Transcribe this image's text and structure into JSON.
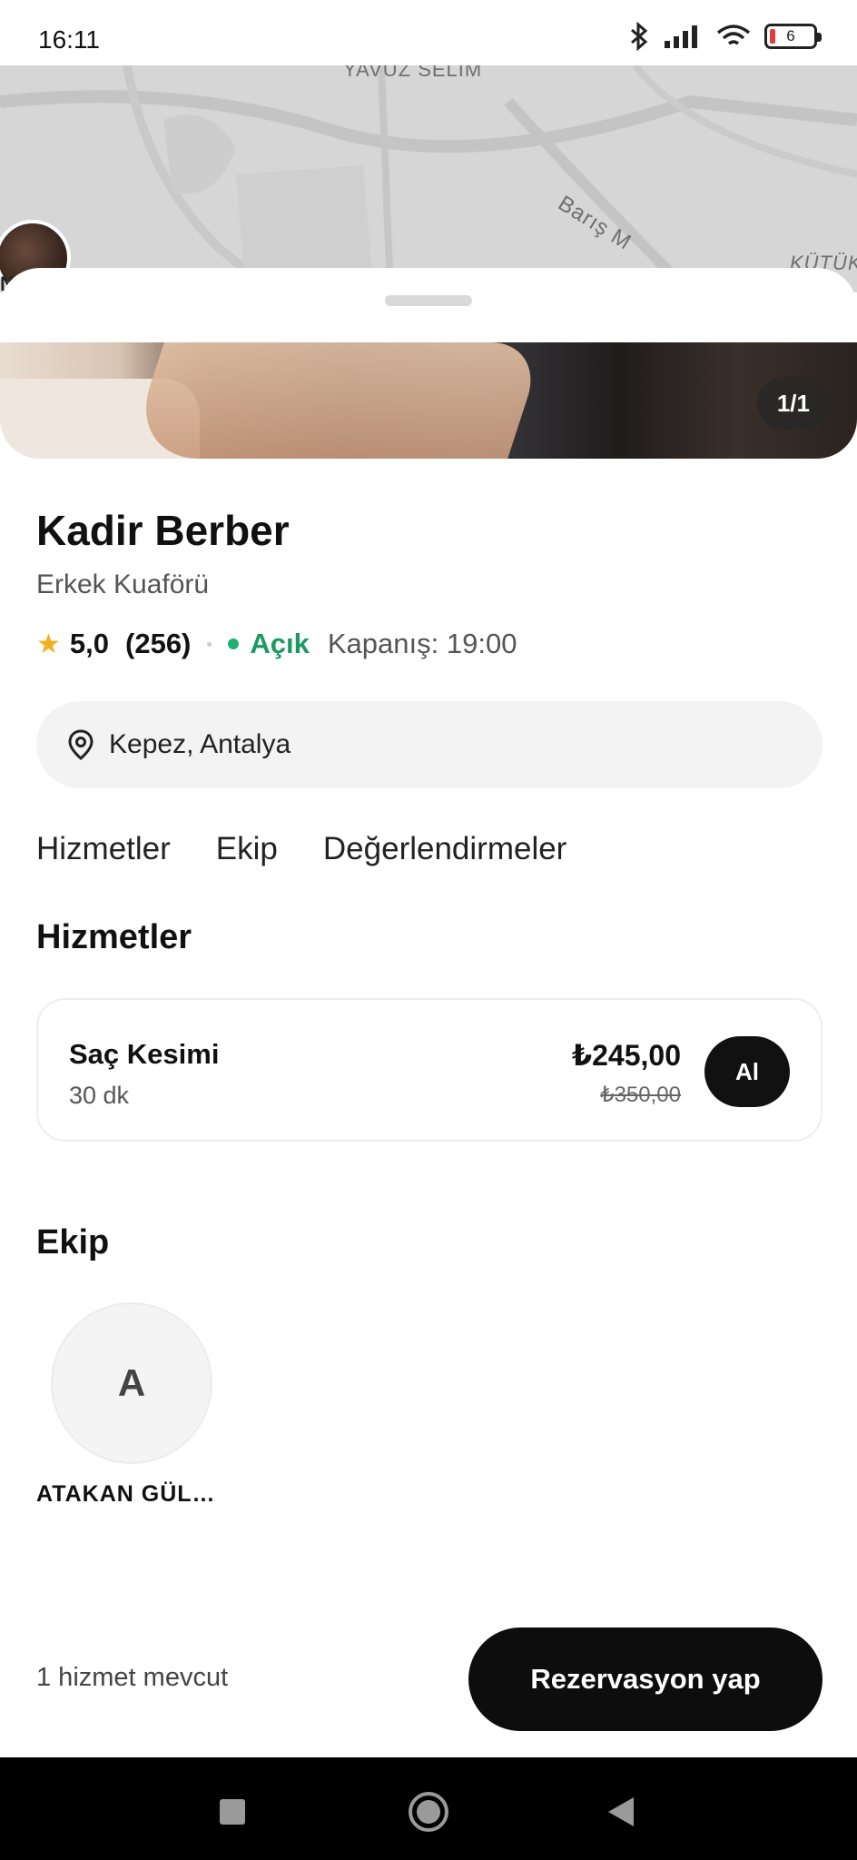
{
  "status_bar": {
    "time": "16:11",
    "battery": "6"
  },
  "map": {
    "street_top": "YAVUZ SELIM",
    "street_diag": "Barış M",
    "street_right": "KÜTÜK",
    "avatar_label": "N"
  },
  "hero": {
    "counter": "1/1"
  },
  "business": {
    "name": "Kadir Berber",
    "category": "Erkek Kuaförü",
    "rating": "5,0",
    "review_count": "(256)",
    "status": "Açık",
    "closing": "Kapanış: 19:00",
    "location": "Kepez, Antalya"
  },
  "tabs": [
    "Hizmetler",
    "Ekip",
    "Değerlendirmeler"
  ],
  "services_section": {
    "title": "Hizmetler"
  },
  "services": [
    {
      "name": "Saç Kesimi",
      "duration": "30 dk",
      "price": "₺245,00",
      "old_price": "₺350,00",
      "button": "Al"
    }
  ],
  "team_section": {
    "title": "Ekip"
  },
  "team": [
    {
      "initial": "A",
      "name": "ATAKAN GÜL…"
    }
  ],
  "footer": {
    "available": "1 hizmet mevcut",
    "reserve_button": "Rezervasyon yap"
  },
  "colors": {
    "accent_open": "#1d9a63",
    "star": "#f2b01e",
    "primary_button": "#0d0d0d"
  }
}
